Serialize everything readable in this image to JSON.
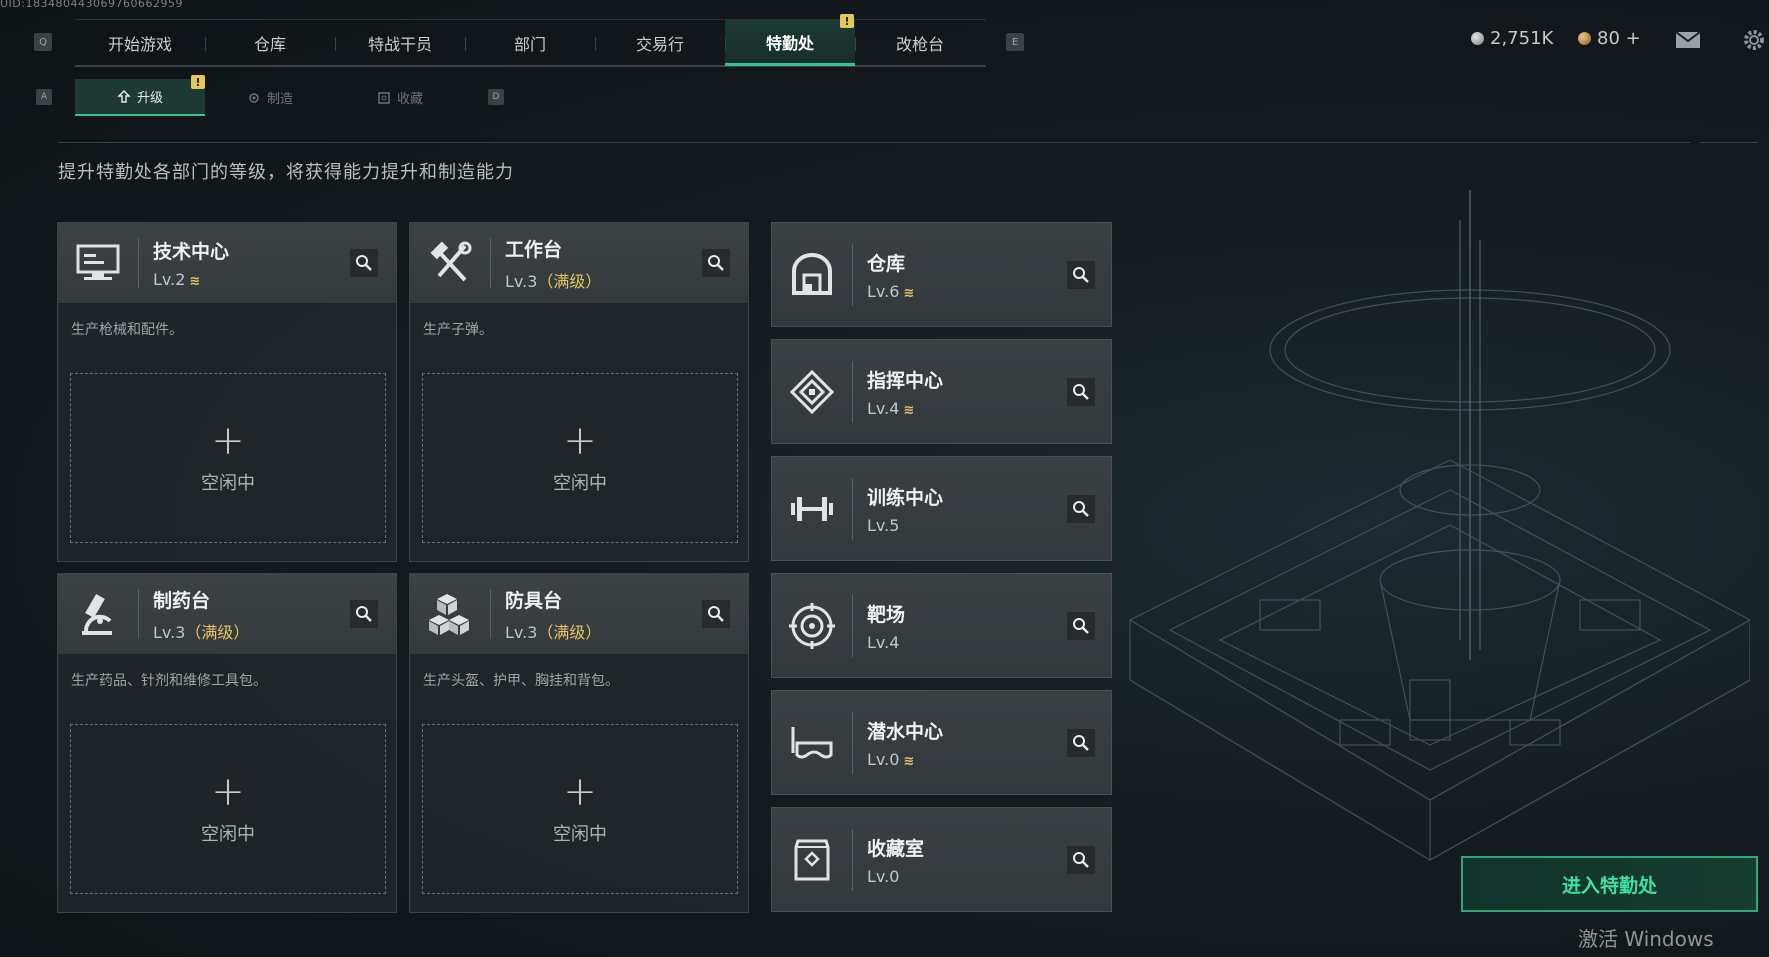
{
  "uid": "UID:183480443069760662959",
  "top_nav": {
    "left_key": "Q",
    "right_key": "E",
    "tabs": [
      {
        "label": "开始游戏"
      },
      {
        "label": "仓库"
      },
      {
        "label": "特战干员"
      },
      {
        "label": "部门"
      },
      {
        "label": "交易行"
      },
      {
        "label": "特勤处",
        "active": true,
        "badge": "!"
      },
      {
        "label": "改枪台"
      }
    ]
  },
  "currency": {
    "silver": "2,751K",
    "gold": "80 +"
  },
  "sub_nav": {
    "left_key": "A",
    "right_key": "D",
    "tabs": [
      {
        "label": "升级",
        "active": true,
        "badge": "!"
      },
      {
        "label": "制造"
      },
      {
        "label": "收藏"
      }
    ]
  },
  "subtitle": "提升特勤处各部门的等级，将获得能力提升和制造能力",
  "production_cards": [
    {
      "name": "技术中心",
      "level": "Lv.2",
      "max_label": "",
      "upgradable": true,
      "desc": "生产枪械和配件。",
      "slot_label": "空闲中"
    },
    {
      "name": "工作台",
      "level": "Lv.3",
      "max_label": "（满级）",
      "upgradable": false,
      "desc": "生产子弹。",
      "slot_label": "空闲中"
    },
    {
      "name": "制药台",
      "level": "Lv.3",
      "max_label": "（满级）",
      "upgradable": false,
      "desc": "生产药品、针剂和维修工具包。",
      "slot_label": "空闲中"
    },
    {
      "name": "防具台",
      "level": "Lv.3",
      "max_label": "（满级）",
      "upgradable": false,
      "desc": "生产头盔、护甲、胸挂和背包。",
      "slot_label": "空闲中"
    }
  ],
  "facility_cards": [
    {
      "name": "仓库",
      "level": "Lv.6",
      "upgradable": true
    },
    {
      "name": "指挥中心",
      "level": "Lv.4",
      "upgradable": true
    },
    {
      "name": "训练中心",
      "level": "Lv.5",
      "upgradable": false
    },
    {
      "name": "靶场",
      "level": "Lv.4",
      "upgradable": false
    },
    {
      "name": "潜水中心",
      "level": "Lv.0",
      "upgradable": true
    },
    {
      "name": "收藏室",
      "level": "Lv.0",
      "upgradable": false
    }
  ],
  "upgrade_mark": "≋",
  "plus_mark": "+",
  "enter_button": "进入特勤处",
  "watermark": "激活 Windows",
  "colors": {
    "accent": "#38c28f",
    "gold": "#e6c463",
    "badge": "#e6c75a"
  }
}
